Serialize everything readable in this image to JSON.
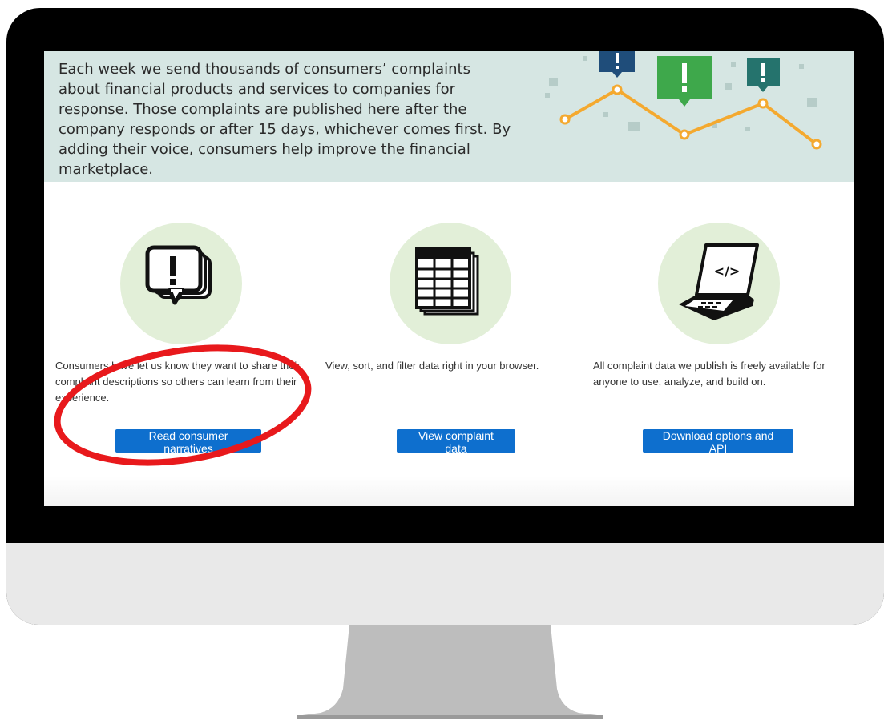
{
  "hero": {
    "text": "Each week we send thousands of consumers’ complaints about financial products and services to companies for response. Those complaints are published here after the company responds or after 15 days, whichever comes first. By adding their voice, consumers help improve the financial marketplace."
  },
  "columns": [
    {
      "icon": "speech-bubbles-exclamation-icon",
      "description": "Consumers have let us know they want to share their complaint descriptions so others can learn from their experience.",
      "button": "Read consumer narratives"
    },
    {
      "icon": "spreadsheet-stack-icon",
      "description": "View, sort, and filter data right in your browser.",
      "button": "View complaint data"
    },
    {
      "icon": "laptop-code-icon",
      "description": "All complaint data we publish is freely available for anyone to use, analyze, and build on.",
      "button": "Download options and API"
    }
  ],
  "colors": {
    "hero_bg": "#d6e6e3",
    "icon_circle": "#e2efd8",
    "button": "#0e6fce",
    "annotation": "#e8191c",
    "chart_line": "#f4a92f"
  }
}
